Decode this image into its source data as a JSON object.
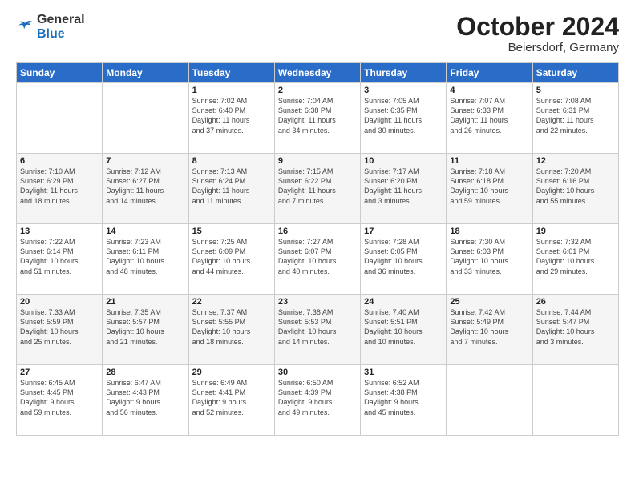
{
  "header": {
    "logo_line1": "General",
    "logo_line2": "Blue",
    "month": "October 2024",
    "location": "Beiersdorf, Germany"
  },
  "weekdays": [
    "Sunday",
    "Monday",
    "Tuesday",
    "Wednesday",
    "Thursday",
    "Friday",
    "Saturday"
  ],
  "weeks": [
    [
      {
        "day": "",
        "content": ""
      },
      {
        "day": "",
        "content": ""
      },
      {
        "day": "1",
        "content": "Sunrise: 7:02 AM\nSunset: 6:40 PM\nDaylight: 11 hours\nand 37 minutes."
      },
      {
        "day": "2",
        "content": "Sunrise: 7:04 AM\nSunset: 6:38 PM\nDaylight: 11 hours\nand 34 minutes."
      },
      {
        "day": "3",
        "content": "Sunrise: 7:05 AM\nSunset: 6:35 PM\nDaylight: 11 hours\nand 30 minutes."
      },
      {
        "day": "4",
        "content": "Sunrise: 7:07 AM\nSunset: 6:33 PM\nDaylight: 11 hours\nand 26 minutes."
      },
      {
        "day": "5",
        "content": "Sunrise: 7:08 AM\nSunset: 6:31 PM\nDaylight: 11 hours\nand 22 minutes."
      }
    ],
    [
      {
        "day": "6",
        "content": "Sunrise: 7:10 AM\nSunset: 6:29 PM\nDaylight: 11 hours\nand 18 minutes."
      },
      {
        "day": "7",
        "content": "Sunrise: 7:12 AM\nSunset: 6:27 PM\nDaylight: 11 hours\nand 14 minutes."
      },
      {
        "day": "8",
        "content": "Sunrise: 7:13 AM\nSunset: 6:24 PM\nDaylight: 11 hours\nand 11 minutes."
      },
      {
        "day": "9",
        "content": "Sunrise: 7:15 AM\nSunset: 6:22 PM\nDaylight: 11 hours\nand 7 minutes."
      },
      {
        "day": "10",
        "content": "Sunrise: 7:17 AM\nSunset: 6:20 PM\nDaylight: 11 hours\nand 3 minutes."
      },
      {
        "day": "11",
        "content": "Sunrise: 7:18 AM\nSunset: 6:18 PM\nDaylight: 10 hours\nand 59 minutes."
      },
      {
        "day": "12",
        "content": "Sunrise: 7:20 AM\nSunset: 6:16 PM\nDaylight: 10 hours\nand 55 minutes."
      }
    ],
    [
      {
        "day": "13",
        "content": "Sunrise: 7:22 AM\nSunset: 6:14 PM\nDaylight: 10 hours\nand 51 minutes."
      },
      {
        "day": "14",
        "content": "Sunrise: 7:23 AM\nSunset: 6:11 PM\nDaylight: 10 hours\nand 48 minutes."
      },
      {
        "day": "15",
        "content": "Sunrise: 7:25 AM\nSunset: 6:09 PM\nDaylight: 10 hours\nand 44 minutes."
      },
      {
        "day": "16",
        "content": "Sunrise: 7:27 AM\nSunset: 6:07 PM\nDaylight: 10 hours\nand 40 minutes."
      },
      {
        "day": "17",
        "content": "Sunrise: 7:28 AM\nSunset: 6:05 PM\nDaylight: 10 hours\nand 36 minutes."
      },
      {
        "day": "18",
        "content": "Sunrise: 7:30 AM\nSunset: 6:03 PM\nDaylight: 10 hours\nand 33 minutes."
      },
      {
        "day": "19",
        "content": "Sunrise: 7:32 AM\nSunset: 6:01 PM\nDaylight: 10 hours\nand 29 minutes."
      }
    ],
    [
      {
        "day": "20",
        "content": "Sunrise: 7:33 AM\nSunset: 5:59 PM\nDaylight: 10 hours\nand 25 minutes."
      },
      {
        "day": "21",
        "content": "Sunrise: 7:35 AM\nSunset: 5:57 PM\nDaylight: 10 hours\nand 21 minutes."
      },
      {
        "day": "22",
        "content": "Sunrise: 7:37 AM\nSunset: 5:55 PM\nDaylight: 10 hours\nand 18 minutes."
      },
      {
        "day": "23",
        "content": "Sunrise: 7:38 AM\nSunset: 5:53 PM\nDaylight: 10 hours\nand 14 minutes."
      },
      {
        "day": "24",
        "content": "Sunrise: 7:40 AM\nSunset: 5:51 PM\nDaylight: 10 hours\nand 10 minutes."
      },
      {
        "day": "25",
        "content": "Sunrise: 7:42 AM\nSunset: 5:49 PM\nDaylight: 10 hours\nand 7 minutes."
      },
      {
        "day": "26",
        "content": "Sunrise: 7:44 AM\nSunset: 5:47 PM\nDaylight: 10 hours\nand 3 minutes."
      }
    ],
    [
      {
        "day": "27",
        "content": "Sunrise: 6:45 AM\nSunset: 4:45 PM\nDaylight: 9 hours\nand 59 minutes."
      },
      {
        "day": "28",
        "content": "Sunrise: 6:47 AM\nSunset: 4:43 PM\nDaylight: 9 hours\nand 56 minutes."
      },
      {
        "day": "29",
        "content": "Sunrise: 6:49 AM\nSunset: 4:41 PM\nDaylight: 9 hours\nand 52 minutes."
      },
      {
        "day": "30",
        "content": "Sunrise: 6:50 AM\nSunset: 4:39 PM\nDaylight: 9 hours\nand 49 minutes."
      },
      {
        "day": "31",
        "content": "Sunrise: 6:52 AM\nSunset: 4:38 PM\nDaylight: 9 hours\nand 45 minutes."
      },
      {
        "day": "",
        "content": ""
      },
      {
        "day": "",
        "content": ""
      }
    ]
  ]
}
